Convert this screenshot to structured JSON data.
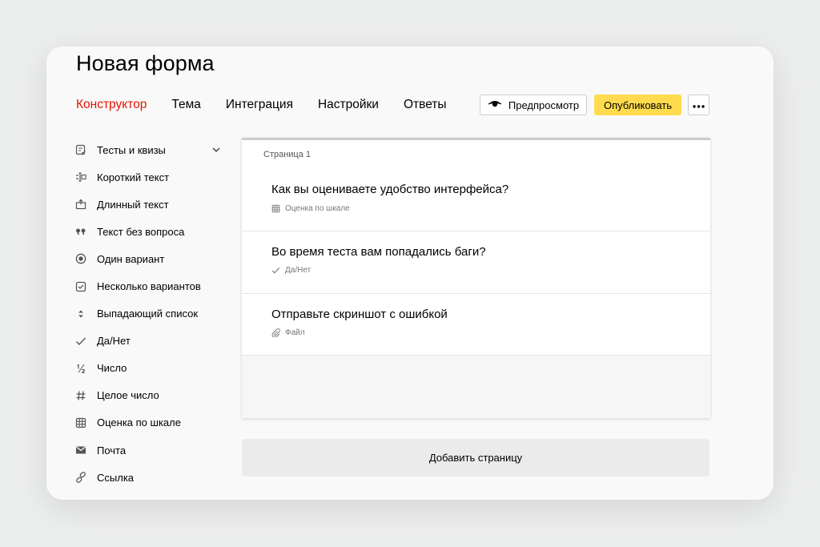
{
  "form": {
    "title": "Новая форма"
  },
  "tabs": [
    {
      "label": "Конструктор",
      "active": true
    },
    {
      "label": "Тема"
    },
    {
      "label": "Интеграция"
    },
    {
      "label": "Настройки"
    },
    {
      "label": "Ответы"
    }
  ],
  "toolbar": {
    "preview_label": "Предпросмотр",
    "publish_label": "Опубликовать",
    "preview_icon": "eye-icon",
    "more_icon": "more-icon"
  },
  "sidebar": {
    "items": [
      {
        "label": "Тесты и квизы",
        "icon": "quiz-icon"
      },
      {
        "label": "Короткий текст",
        "icon": "short-text-icon"
      },
      {
        "label": "Длинный текст",
        "icon": "long-text-icon"
      },
      {
        "label": "Текст без вопроса",
        "icon": "quote-icon"
      },
      {
        "label": "Один вариант",
        "icon": "radio-icon"
      },
      {
        "label": "Несколько вариантов",
        "icon": "checkbox-icon"
      },
      {
        "label": "Выпадающий список",
        "icon": "dropdown-icon"
      },
      {
        "label": "Да/Нет",
        "icon": "check-icon"
      },
      {
        "label": "Число",
        "icon": "fraction-icon"
      },
      {
        "label": "Целое число",
        "icon": "hash-icon"
      },
      {
        "label": "Оценка по шкале",
        "icon": "grid-icon"
      },
      {
        "label": "Почта",
        "icon": "mail-icon"
      },
      {
        "label": "Ссылка",
        "icon": "link-icon"
      }
    ]
  },
  "page": {
    "label": "Страница 1",
    "questions": [
      {
        "text": "Как вы оцениваете удобство интерфейса?",
        "type": "Оценка по шкале",
        "icon": "grid-icon"
      },
      {
        "text": "Во время теста вам попадались баги?",
        "type": "Да/Нет",
        "icon": "check-icon"
      },
      {
        "text": "Отправьте скриншот с ошибкой",
        "type": "Файл",
        "icon": "paperclip-icon"
      }
    ]
  },
  "add_page_label": "Добавить страницу",
  "colors": {
    "accent": "#e61400",
    "publish": "#ffdb4d"
  }
}
